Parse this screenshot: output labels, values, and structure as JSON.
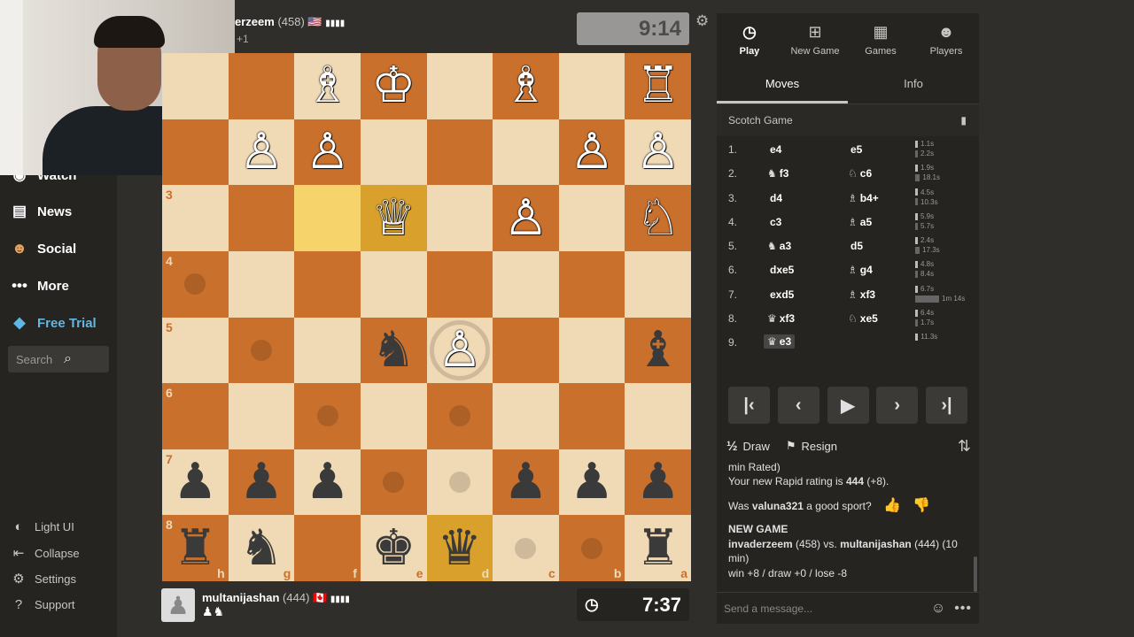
{
  "sidebar": {
    "items": [
      {
        "label": "Watch",
        "icon": "watch-icon"
      },
      {
        "label": "News",
        "icon": "news-icon"
      },
      {
        "label": "Social",
        "icon": "social-icon"
      },
      {
        "label": "More",
        "icon": "more-icon"
      },
      {
        "label": "Free Trial",
        "icon": "diamond-icon"
      }
    ],
    "search_placeholder": "Search",
    "bottom": [
      {
        "label": "Light UI",
        "icon": "light-ui-icon"
      },
      {
        "label": "Collapse",
        "icon": "collapse-icon"
      },
      {
        "label": "Settings",
        "icon": "settings-icon"
      },
      {
        "label": "Support",
        "icon": "support-icon"
      }
    ]
  },
  "opponent": {
    "name": "erzeem",
    "rating": "(458)",
    "flag": "🇺🇸",
    "captured": "+1",
    "clock": "9:14"
  },
  "player": {
    "name": "multanijashan",
    "rating": "(444)",
    "flag": "🇨🇦",
    "captured": "♟♞",
    "clock": "7:37"
  },
  "board": {
    "ranks": [
      "",
      "",
      "3",
      "4",
      "5",
      "6",
      "7",
      "8"
    ],
    "files": [
      "h",
      "g",
      "f",
      "e",
      "d",
      "c",
      "b",
      "a"
    ],
    "pieces": [
      [
        "",
        "",
        "♗",
        "♔",
        "",
        "♗",
        "",
        "♖"
      ],
      [
        "",
        "♙",
        "♙",
        "",
        "",
        "",
        "♙",
        "♙"
      ],
      [
        "",
        "",
        "",
        "♕",
        "",
        "♙",
        "",
        "♘"
      ],
      [
        "",
        "",
        "",
        "",
        "",
        "",
        "",
        ""
      ],
      [
        "",
        "",
        "",
        "♞",
        "♙",
        "",
        "",
        "♝"
      ],
      [
        "",
        "",
        "",
        "",
        "",
        "",
        "",
        ""
      ],
      [
        "♟",
        "♟",
        "♟",
        "",
        "",
        "♟",
        "♟",
        "♟"
      ],
      [
        "♜",
        "♞",
        "",
        "♚",
        "♛",
        "",
        "",
        "♜"
      ]
    ],
    "colors": [
      [
        "",
        "",
        "w",
        "w",
        "",
        "w",
        "",
        "w"
      ],
      [
        "",
        "w",
        "w",
        "",
        "",
        "",
        "w",
        "w"
      ],
      [
        "",
        "",
        "",
        "w",
        "",
        "w",
        "",
        "w"
      ],
      [
        "",
        "",
        "",
        "",
        "",
        "",
        "",
        ""
      ],
      [
        "",
        "",
        "",
        "b",
        "w",
        "",
        "",
        "b"
      ],
      [
        "",
        "",
        "",
        "",
        "",
        "",
        "",
        ""
      ],
      [
        "b",
        "b",
        "b",
        "",
        "",
        "b",
        "b",
        "b"
      ],
      [
        "b",
        "b",
        "",
        "b",
        "b",
        "",
        "",
        "b"
      ]
    ],
    "highlights": [
      [
        2,
        2
      ],
      [
        2,
        3
      ],
      [
        7,
        4
      ]
    ],
    "dots": [
      [
        3,
        0
      ],
      [
        4,
        1
      ],
      [
        5,
        2
      ],
      [
        5,
        4
      ],
      [
        6,
        3
      ],
      [
        6,
        4
      ],
      [
        7,
        5
      ],
      [
        7,
        6
      ]
    ],
    "rings": [
      [
        4,
        4
      ]
    ]
  },
  "panel": {
    "tabs": [
      {
        "label": "Play",
        "icon": "play-clock-icon"
      },
      {
        "label": "New Game",
        "icon": "new-game-icon"
      },
      {
        "label": "Games",
        "icon": "games-board-icon"
      },
      {
        "label": "Players",
        "icon": "players-icon"
      }
    ],
    "subtabs": [
      "Moves",
      "Info"
    ],
    "opening": "Scotch Game",
    "moves": [
      {
        "num": "1.",
        "white": "e4",
        "wg": "",
        "black": "e5",
        "bg": "",
        "wt": "1.1s",
        "bt": "2.2s",
        "wf": 0.03,
        "bf": 0.04
      },
      {
        "num": "2.",
        "white": "f3",
        "wg": "♞",
        "black": "c6",
        "bg": "♘",
        "wt": "1.9s",
        "bt": "18.1s",
        "wf": 0.04,
        "bf": 0.18
      },
      {
        "num": "3.",
        "white": "d4",
        "wg": "",
        "black": "b4+",
        "bg": "♗",
        "wt": "4.5s",
        "bt": "10.3s",
        "wf": 0.05,
        "bf": 0.1
      },
      {
        "num": "4.",
        "white": "c3",
        "wg": "",
        "black": "a5",
        "bg": "♗",
        "wt": "5.9s",
        "bt": "5.7s",
        "wf": 0.06,
        "bf": 0.06
      },
      {
        "num": "5.",
        "white": "a3",
        "wg": "♞",
        "black": "d5",
        "bg": "",
        "wt": "2.4s",
        "bt": "17.3s",
        "wf": 0.03,
        "bf": 0.17
      },
      {
        "num": "6.",
        "white": "dxe5",
        "wg": "",
        "black": "g4",
        "bg": "♗",
        "wt": "4.8s",
        "bt": "8.4s",
        "wf": 0.05,
        "bf": 0.08
      },
      {
        "num": "7.",
        "white": "exd5",
        "wg": "",
        "black": "xf3",
        "bg": "♗",
        "wt": "6.7s",
        "bt": "1m 14s",
        "wf": 0.07,
        "bf": 0.9
      },
      {
        "num": "8.",
        "white": "xf3",
        "wg": "♛",
        "black": "xe5",
        "bg": "♘",
        "wt": "6.4s",
        "bt": "1.7s",
        "wf": 0.06,
        "bf": 0.03
      },
      {
        "num": "9.",
        "white": "e3",
        "wg": "♛",
        "black": "",
        "bg": "",
        "wt": "11.3s",
        "bt": "",
        "wf": 0.11,
        "bf": 0
      }
    ],
    "controls": [
      "first-move-icon",
      "prev-move-icon",
      "play-icon",
      "next-move-icon",
      "last-move-icon"
    ],
    "draw_label": "Draw",
    "draw_glyph": "½",
    "resign_label": "Resign",
    "chat": {
      "line1": "min Rated)",
      "line2_prefix": "Your new Rapid rating is ",
      "line2_value": "444",
      "line2_suffix": " (+8).",
      "sport_prefix": "Was ",
      "sport_name": "valuna321",
      "sport_suffix": " a good sport?",
      "new_game": "NEW GAME",
      "matchup_white": "invaderzeem",
      "matchup_mid": " (458) vs. ",
      "matchup_black": "multanijashan",
      "matchup_tail": " (444) (10",
      "matchup_tail2": "min)",
      "results": "win +8 / draw +0 / lose -8"
    },
    "message_placeholder": "Send a message..."
  }
}
